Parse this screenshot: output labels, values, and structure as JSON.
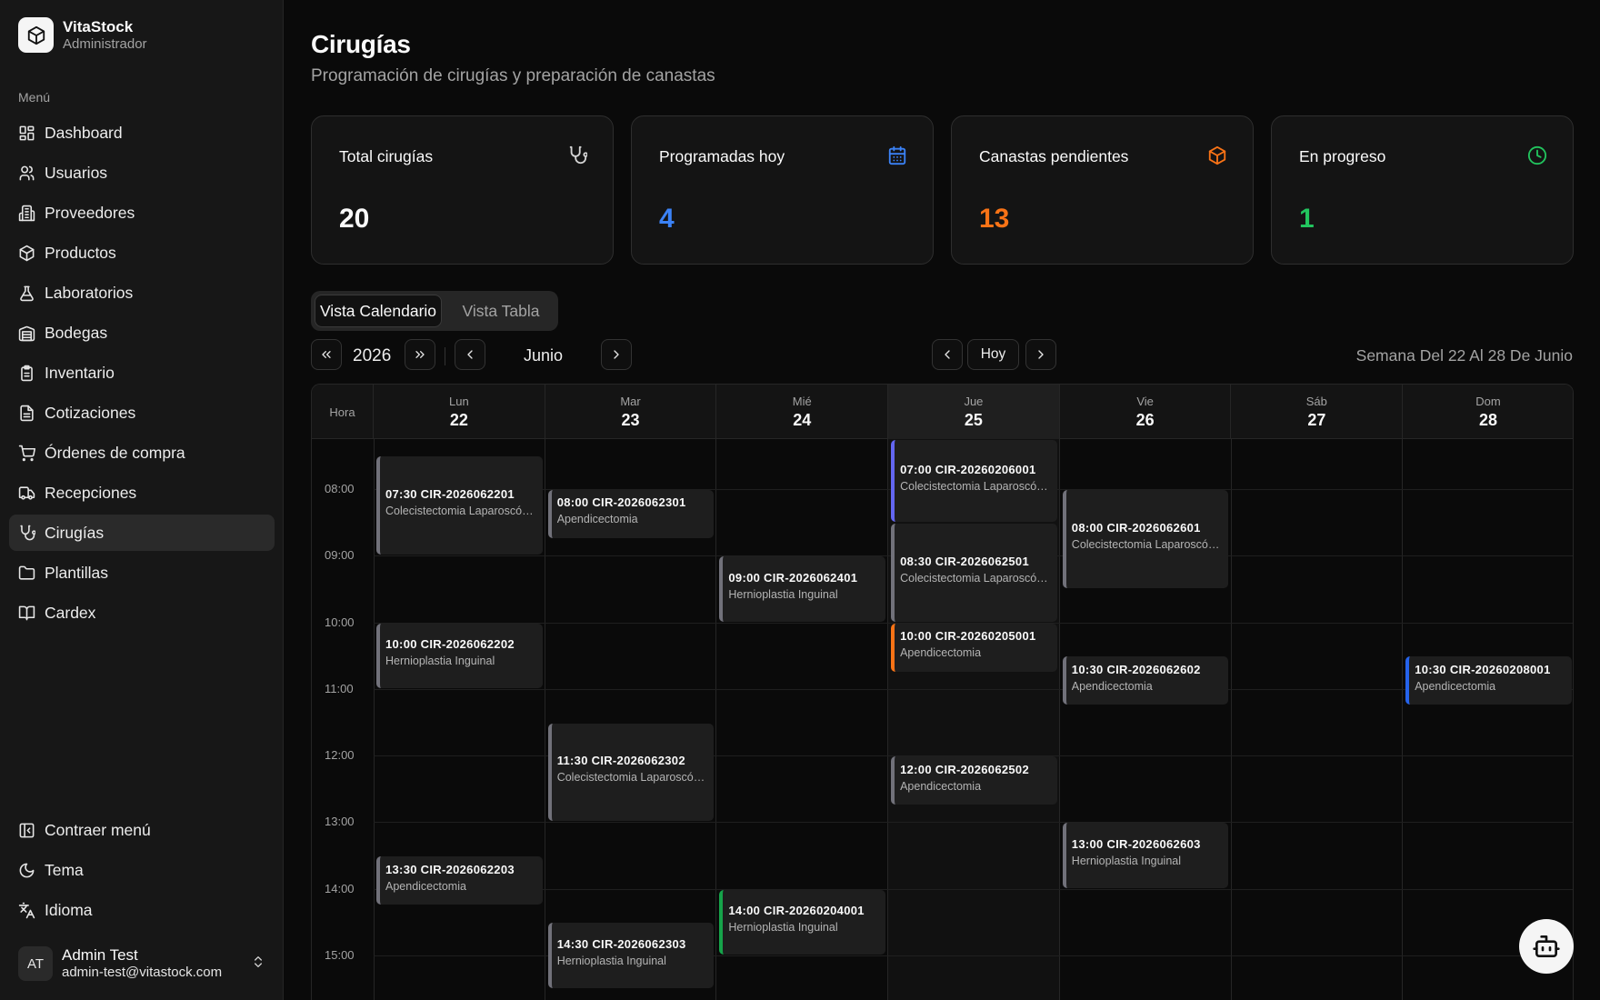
{
  "brand": {
    "name": "VitaStock",
    "role": "Administrador"
  },
  "sidebar": {
    "menu_label": "Menú",
    "items": [
      {
        "label": "Dashboard",
        "icon": "dashboard-icon"
      },
      {
        "label": "Usuarios",
        "icon": "users-icon"
      },
      {
        "label": "Proveedores",
        "icon": "building-icon"
      },
      {
        "label": "Productos",
        "icon": "box-icon"
      },
      {
        "label": "Laboratorios",
        "icon": "flask-icon"
      },
      {
        "label": "Bodegas",
        "icon": "warehouse-icon"
      },
      {
        "label": "Inventario",
        "icon": "clipboard-icon"
      },
      {
        "label": "Cotizaciones",
        "icon": "file-icon"
      },
      {
        "label": "Órdenes de compra",
        "icon": "cart-icon"
      },
      {
        "label": "Recepciones",
        "icon": "truck-icon"
      },
      {
        "label": "Cirugías",
        "icon": "stethoscope-icon",
        "active": true
      },
      {
        "label": "Plantillas",
        "icon": "folder-icon"
      },
      {
        "label": "Cardex",
        "icon": "book-icon"
      }
    ],
    "bottom": [
      {
        "label": "Contraer menú",
        "icon": "collapse-icon"
      },
      {
        "label": "Tema",
        "icon": "moon-icon"
      },
      {
        "label": "Idioma",
        "icon": "language-icon"
      }
    ]
  },
  "user": {
    "initials": "AT",
    "name": "Admin Test",
    "email": "admin-test@vitastock.com"
  },
  "header": {
    "title": "Cirugías",
    "subtitle": "Programación de cirugías y preparación de canastas"
  },
  "stats": [
    {
      "label": "Total cirugías",
      "value": "20",
      "color": "#fafafa",
      "icon": "stethoscope-icon",
      "icon_color": "#d4d4d4"
    },
    {
      "label": "Programadas hoy",
      "value": "4",
      "color": "#3b82f6",
      "icon": "calendar-icon",
      "icon_color": "#3b82f6"
    },
    {
      "label": "Canastas pendientes",
      "value": "13",
      "color": "#f97316",
      "icon": "box-icon",
      "icon_color": "#f97316"
    },
    {
      "label": "En progreso",
      "value": "1",
      "color": "#22c55e",
      "icon": "clock-icon",
      "icon_color": "#22c55e"
    }
  ],
  "view_toggle": {
    "calendar": "Vista Calendario",
    "table": "Vista Tabla"
  },
  "controls": {
    "year": "2026",
    "month": "Junio",
    "today": "Hoy",
    "week_label": "Semana Del 22 Al 28 De Junio"
  },
  "calendar": {
    "hora_label": "Hora",
    "days": [
      {
        "name": "Lun",
        "date": "22"
      },
      {
        "name": "Mar",
        "date": "23"
      },
      {
        "name": "Mié",
        "date": "24"
      },
      {
        "name": "Jue",
        "date": "25",
        "today": true
      },
      {
        "name": "Vie",
        "date": "26"
      },
      {
        "name": "Sáb",
        "date": "27"
      },
      {
        "name": "Dom",
        "date": "28"
      }
    ],
    "hours": [
      "08:00",
      "09:00",
      "10:00",
      "11:00",
      "12:00",
      "13:00",
      "14:00",
      "15:00"
    ],
    "events": [
      {
        "day": 0,
        "start": "07:30",
        "duration_min": 90,
        "title": "07:30 CIR-2026062201",
        "procedure": "Colecistectomia Laparoscópica",
        "color": "#71717a"
      },
      {
        "day": 0,
        "start": "10:00",
        "duration_min": 60,
        "title": "10:00 CIR-2026062202",
        "procedure": "Hernioplastia Inguinal",
        "color": "#71717a"
      },
      {
        "day": 0,
        "start": "13:30",
        "duration_min": 45,
        "title": "13:30 CIR-2026062203",
        "procedure": "Apendicectomia",
        "color": "#71717a"
      },
      {
        "day": 1,
        "start": "08:00",
        "duration_min": 45,
        "title": "08:00 CIR-2026062301",
        "procedure": "Apendicectomia",
        "color": "#71717a"
      },
      {
        "day": 1,
        "start": "11:30",
        "duration_min": 90,
        "title": "11:30 CIR-2026062302",
        "procedure": "Colecistectomia Laparoscópica",
        "color": "#71717a"
      },
      {
        "day": 1,
        "start": "14:30",
        "duration_min": 60,
        "title": "14:30 CIR-2026062303",
        "procedure": "Hernioplastia Inguinal",
        "color": "#71717a"
      },
      {
        "day": 2,
        "start": "09:00",
        "duration_min": 60,
        "title": "09:00 CIR-2026062401",
        "procedure": "Hernioplastia Inguinal",
        "color": "#71717a"
      },
      {
        "day": 2,
        "start": "14:00",
        "duration_min": 60,
        "title": "14:00 CIR-20260204001",
        "procedure": "Hernioplastia Inguinal",
        "color": "#16a34a"
      },
      {
        "day": 3,
        "start": "07:00",
        "duration_min": 90,
        "title": "07:00 CIR-20260206001",
        "procedure": "Colecistectomia Laparoscópica",
        "color": "#6366f1"
      },
      {
        "day": 3,
        "start": "08:30",
        "duration_min": 90,
        "title": "08:30 CIR-2026062501",
        "procedure": "Colecistectomia Laparoscópica",
        "color": "#71717a"
      },
      {
        "day": 3,
        "start": "10:00",
        "duration_min": 45,
        "title": "10:00 CIR-20260205001",
        "procedure": "Apendicectomia",
        "color": "#f97316"
      },
      {
        "day": 3,
        "start": "12:00",
        "duration_min": 45,
        "title": "12:00 CIR-2026062502",
        "procedure": "Apendicectomia",
        "color": "#71717a"
      },
      {
        "day": 4,
        "start": "08:00",
        "duration_min": 90,
        "title": "08:00 CIR-2026062601",
        "procedure": "Colecistectomia Laparoscópica",
        "color": "#71717a"
      },
      {
        "day": 4,
        "start": "10:30",
        "duration_min": 45,
        "title": "10:30 CIR-2026062602",
        "procedure": "Apendicectomia",
        "color": "#71717a"
      },
      {
        "day": 4,
        "start": "13:00",
        "duration_min": 60,
        "title": "13:00 CIR-2026062603",
        "procedure": "Hernioplastia Inguinal",
        "color": "#71717a"
      },
      {
        "day": 6,
        "start": "10:30",
        "duration_min": 45,
        "title": "10:30 CIR-20260208001",
        "procedure": "Apendicectomia",
        "color": "#2563eb"
      }
    ]
  }
}
